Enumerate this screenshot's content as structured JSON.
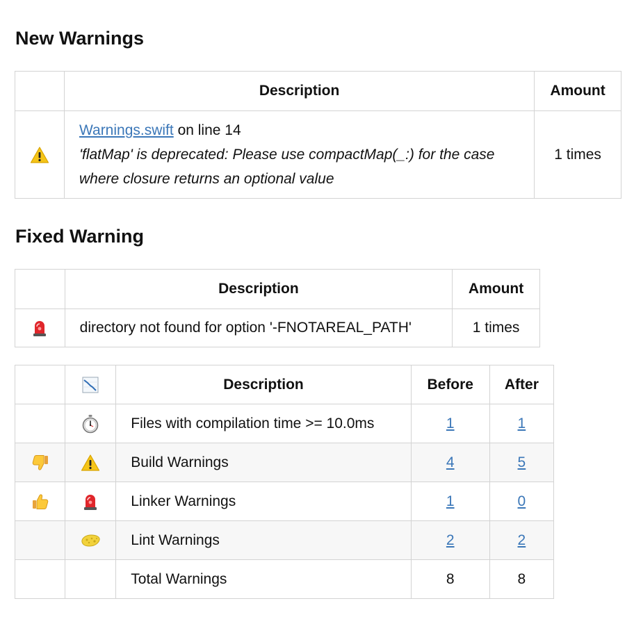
{
  "new_warnings": {
    "title": "New Warnings",
    "headers": {
      "icon": "",
      "description": "Description",
      "amount": "Amount"
    },
    "rows": [
      {
        "icon": "warning-icon",
        "file_link": "Warnings.swift",
        "line_text": " on line 14",
        "message": "'flatMap' is deprecated: Please use compactMap(_:) for the case where closure returns an optional value",
        "amount": "1 times"
      }
    ]
  },
  "fixed_warning": {
    "title": "Fixed Warning",
    "headers": {
      "icon": "",
      "description": "Description",
      "amount": "Amount"
    },
    "rows": [
      {
        "icon": "siren-icon",
        "description": "directory not found for option '-FNOTAREAL_PATH'",
        "amount": "1 times"
      }
    ]
  },
  "summary": {
    "headers": {
      "trend": "",
      "icon": "chart-decreasing-icon",
      "description": "Description",
      "before": "Before",
      "after": "After"
    },
    "rows": [
      {
        "trend": "",
        "icon": "stopwatch-icon",
        "description": "Files with compilation time >= 10.0ms",
        "before": "1",
        "after": "1",
        "linked": true
      },
      {
        "trend": "thumbs-down-icon",
        "icon": "warning-icon",
        "description": "Build Warnings",
        "before": "4",
        "after": "5",
        "linked": true
      },
      {
        "trend": "thumbs-up-icon",
        "icon": "siren-icon",
        "description": "Linker Warnings",
        "before": "1",
        "after": "0",
        "linked": true
      },
      {
        "trend": "",
        "icon": "sponge-icon",
        "description": "Lint Warnings",
        "before": "2",
        "after": "2",
        "linked": true
      },
      {
        "trend": "",
        "icon": "",
        "description": "Total Warnings",
        "before": "8",
        "after": "8",
        "linked": false
      }
    ]
  },
  "colors": {
    "link": "#3b77b8",
    "border": "#d3d3d3",
    "alt_row": "#f7f7f7",
    "warning_yellow": "#f5c518",
    "siren_red": "#e0262b"
  }
}
